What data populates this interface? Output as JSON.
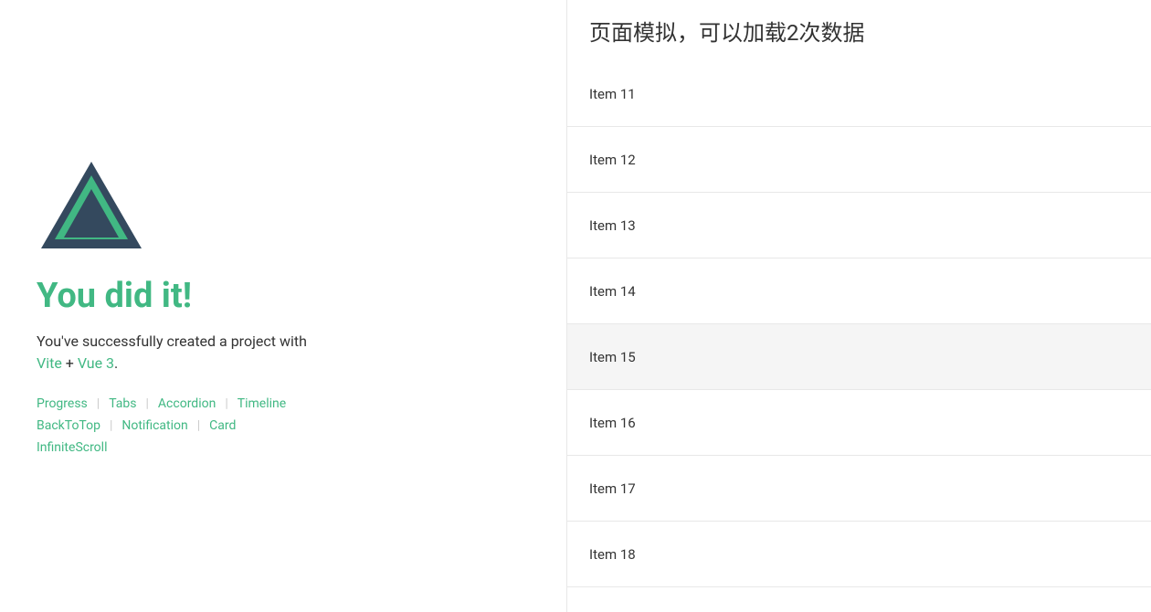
{
  "left": {
    "title": "You did it!",
    "subtitle_text": "You've successfully created a project with",
    "vite_link": "Vite",
    "plus_text": " + ",
    "vue_link": "Vue 3",
    "period": ".",
    "nav_rows": [
      {
        "items": [
          "Progress",
          "Tabs",
          "Accordion",
          "Timeline"
        ]
      },
      {
        "items": [
          "BackToTop",
          "Notification",
          "Card"
        ]
      },
      {
        "items": [
          "InfiniteScroll"
        ]
      }
    ]
  },
  "right": {
    "header": "页面模拟，可以加载2次数据",
    "items": [
      {
        "label": "Item 11"
      },
      {
        "label": "Item 12"
      },
      {
        "label": "Item 13"
      },
      {
        "label": "Item 14"
      },
      {
        "label": "Item 15"
      },
      {
        "label": "Item 16"
      },
      {
        "label": "Item 17"
      },
      {
        "label": "Item 18"
      }
    ]
  },
  "colors": {
    "green": "#41b883",
    "dark_green": "#34495e"
  }
}
